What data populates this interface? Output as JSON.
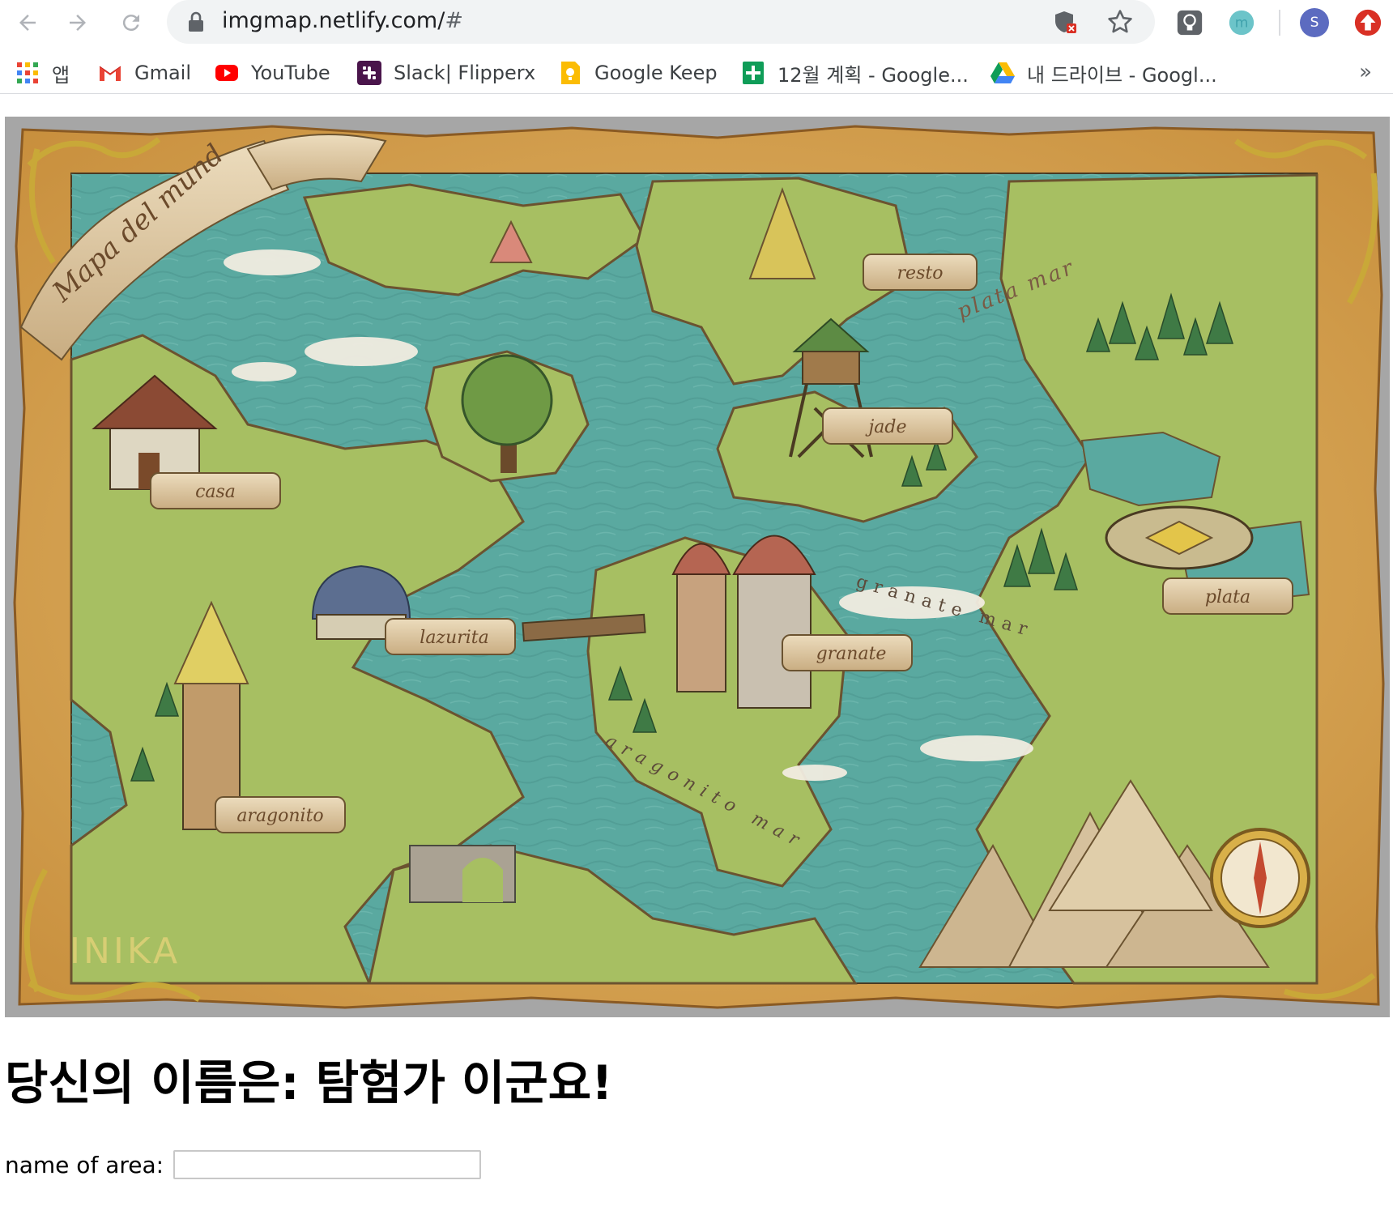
{
  "browser": {
    "url_host": "imgmap.netlify.com/",
    "url_rest": "#",
    "profile_initial": "S",
    "bookmarks": [
      {
        "label": "앱",
        "icon": "apps-grid-icon"
      },
      {
        "label": "Gmail",
        "icon": "gmail-icon"
      },
      {
        "label": "YouTube",
        "icon": "youtube-icon"
      },
      {
        "label": "Slack| Flipperx",
        "icon": "slack-icon"
      },
      {
        "label": "Google Keep",
        "icon": "google-keep-icon"
      },
      {
        "label": "12월 계획 - Google...",
        "icon": "google-sheets-icon"
      },
      {
        "label": "내 드라이브 - Googl...",
        "icon": "google-drive-icon"
      }
    ],
    "more_label": "»"
  },
  "map": {
    "title": "Mapa del mund",
    "signature": "INIKA",
    "labels": {
      "resto": "resto",
      "jade": "jade",
      "casa": "casa",
      "lazurita": "lazurita",
      "granate": "granate",
      "plata": "plata",
      "aragonito": "aragonito",
      "plata_mar": "plata mar",
      "granate_mar": "granate mar",
      "aragonito_mar": "aragonito mar"
    }
  },
  "page": {
    "heading": "당신의 이름은: 탐험가 이군요!",
    "area_label": "name of area:",
    "area_value": ""
  },
  "colors": {
    "sea": "#5aa9a0",
    "land": "#a7bf62",
    "parchment": "#d9a957",
    "scroll": "#dcc6a0",
    "gold": "#c9a838"
  }
}
